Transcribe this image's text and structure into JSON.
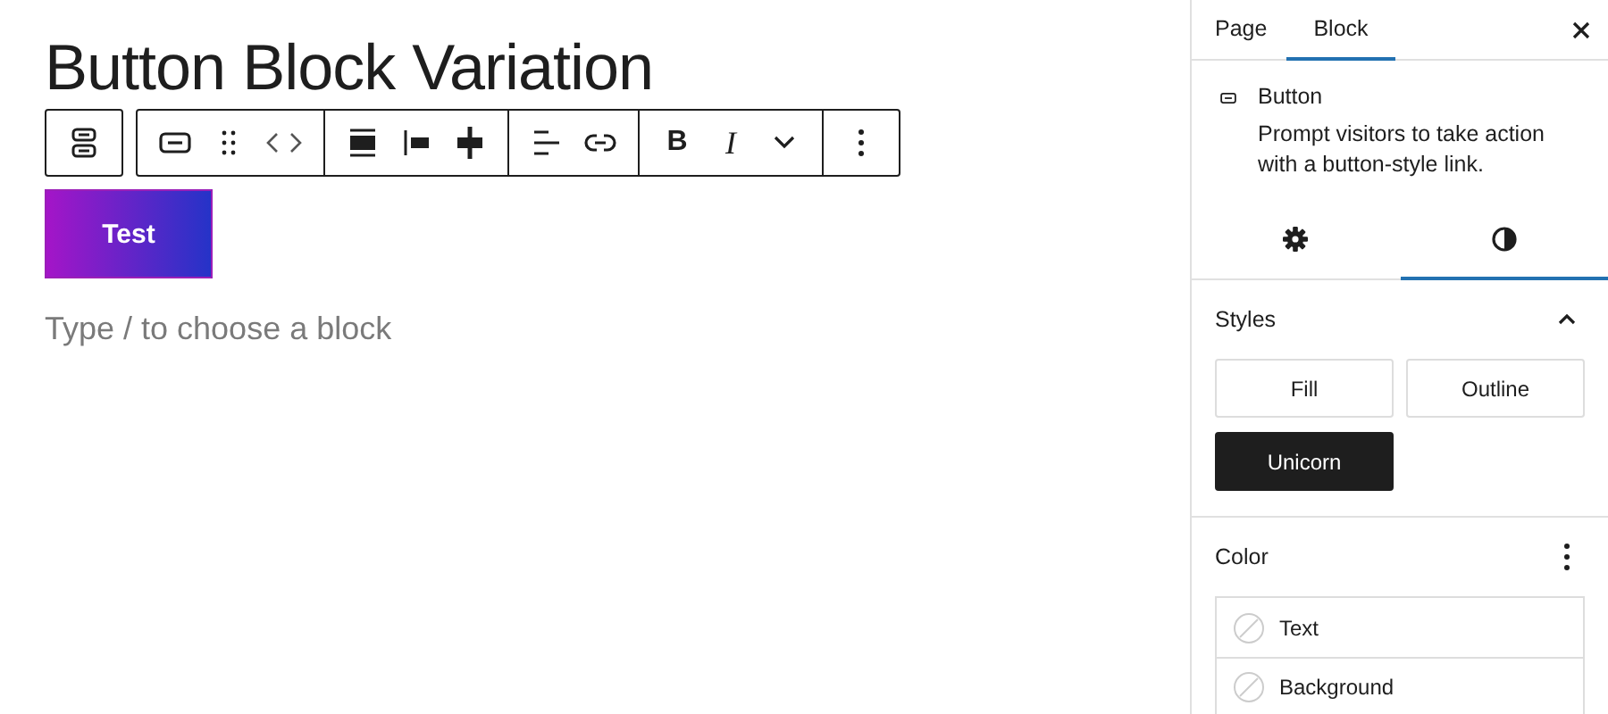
{
  "editor": {
    "title": "Button Block Variation",
    "format_buttons": [
      "B",
      "I"
    ],
    "button": {
      "label": "Test"
    },
    "placeholder": "Type / to choose a block"
  },
  "sidebar": {
    "tabs": [
      {
        "label": "Page",
        "selected": false
      },
      {
        "label": "Block",
        "selected": true
      }
    ],
    "block": {
      "name": "Button",
      "description": "Prompt visitors to take action with a button-style link."
    },
    "panel_tabs": [
      {
        "kind": "settings",
        "selected": false
      },
      {
        "kind": "styles",
        "selected": true
      }
    ],
    "styles": {
      "title": "Styles",
      "expanded": true,
      "options": [
        {
          "label": "Fill",
          "selected": false
        },
        {
          "label": "Outline",
          "selected": false
        },
        {
          "label": "Unicorn",
          "selected": true
        }
      ]
    },
    "color": {
      "title": "Color",
      "items": [
        {
          "label": "Text"
        },
        {
          "label": "Background"
        }
      ]
    }
  }
}
